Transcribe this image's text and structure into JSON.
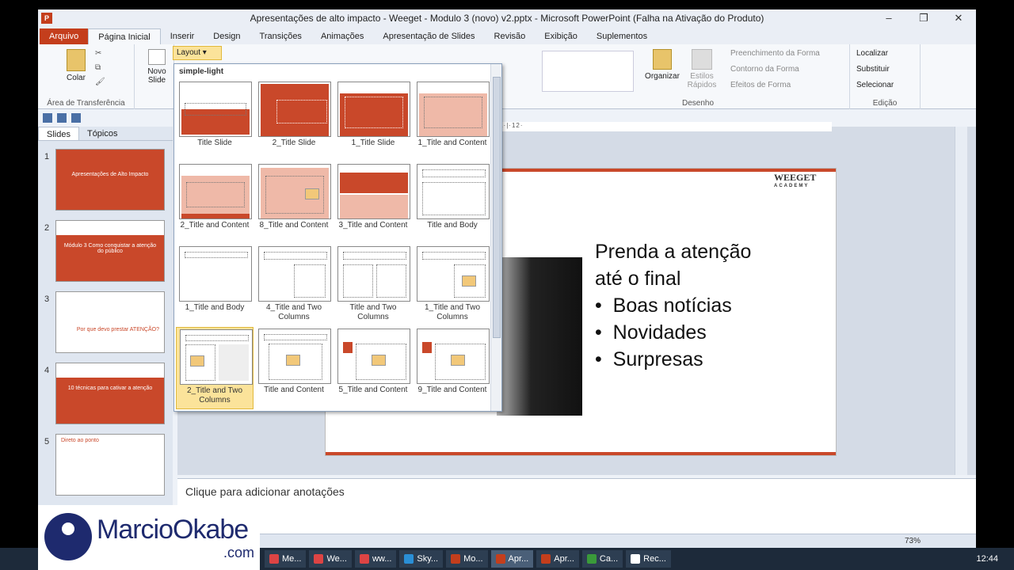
{
  "window": {
    "title": "Apresentações de alto impacto - Weeget - Modulo 3 (novo) v2.pptx - Microsoft PowerPoint (Falha na Ativação do Produto)",
    "app_icon": "P"
  },
  "ribbon_tabs": [
    "Arquivo",
    "Página Inicial",
    "Inserir",
    "Design",
    "Transições",
    "Animações",
    "Apresentação de Slides",
    "Revisão",
    "Exibição",
    "Suplementos"
  ],
  "ribbon": {
    "clipboard": {
      "paste": "Colar",
      "group": "Área de Transferência"
    },
    "slides": {
      "new_slide": "Novo Slide",
      "layout": "Layout"
    },
    "drawing": {
      "arrange": "Organizar",
      "quick_styles": "Estilos Rápidos",
      "fill": "Preenchimento da Forma",
      "outline": "Contorno da Forma",
      "effects": "Efeitos de Forma",
      "group": "Desenho"
    },
    "editing": {
      "find": "Localizar",
      "replace": "Substituir",
      "select": "Selecionar",
      "group": "Edição"
    }
  },
  "left_panel": {
    "tabs": [
      "Slides",
      "Tópicos"
    ],
    "thumbs": [
      {
        "num": "1",
        "text": "Apresentações de Alto Impacto"
      },
      {
        "num": "2",
        "text": "Módulo 3 Como conquistar a atenção do público"
      },
      {
        "num": "3",
        "text": "Por que devo prestar ATENÇÃO?"
      },
      {
        "num": "4",
        "text": "10 técnicas para cativar a atenção"
      },
      {
        "num": "5",
        "text": "Direto ao ponto"
      }
    ]
  },
  "gallery": {
    "header": "simple-light",
    "items": [
      "Title Slide",
      "2_Title Slide",
      "1_Title Slide",
      "1_Title and Content",
      "2_Title and Content",
      "8_Title and Content",
      "3_Title and Content",
      "Title and Body",
      "1_Title and Body",
      "4_Title and Two Columns",
      "Title and Two Columns",
      "1_Title and Two Columns",
      "2_Title and Two Columns",
      "Title and Content",
      "5_Title and Content",
      "9_Title and Content"
    ]
  },
  "slide": {
    "logo": "WEEGET",
    "logo_sub": "ACADEMY",
    "line1": "Prenda a atenção",
    "line2": "até o final",
    "bullets": [
      "Boas notícias",
      "Novidades",
      "Surpresas"
    ]
  },
  "notes_placeholder": "Clique para adicionar anotações",
  "ruler": "·2·|·1·|·0·|·1·|·2·|·3·|·4·|·5·|·6·|·7·|·8·|·9·|·10·|·11·|·12·",
  "status": {
    "zoom": "73%"
  },
  "taskbar": {
    "items": [
      "Me...",
      "We...",
      "ww...",
      "Sky...",
      "Mo...",
      "Apr...",
      "Apr...",
      "Ca...",
      "Rec..."
    ],
    "clock": "12:44"
  },
  "brand": {
    "name": "MarcioOkabe",
    "domain": ".com"
  }
}
